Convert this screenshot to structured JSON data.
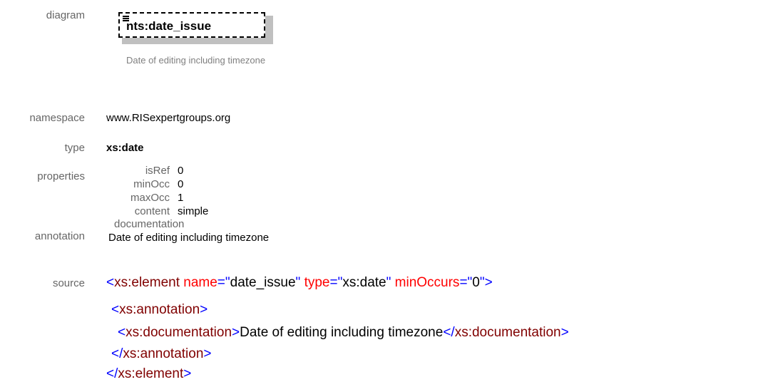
{
  "labels": {
    "diagram": "diagram",
    "namespace": "namespace",
    "type": "type",
    "properties": "properties",
    "annotation": "annotation",
    "source": "source"
  },
  "diagram": {
    "element_name": "nts:date_issue",
    "element_doc": "Date of editing including timezone"
  },
  "namespace": "www.RISexpertgroups.org",
  "type": "xs:date",
  "properties": [
    {
      "key": "isRef",
      "value": "0"
    },
    {
      "key": "minOcc",
      "value": "0"
    },
    {
      "key": "maxOcc",
      "value": "1"
    },
    {
      "key": "content",
      "value": "simple"
    }
  ],
  "annotation": {
    "heading": "documentation",
    "text": "Date of editing including timezone"
  },
  "source": {
    "line1": {
      "open": "<",
      "tag": "xs:element",
      "attr1": "name",
      "eq1": "=\"",
      "val1": "date_issue",
      "q1": "\"",
      "attr2": "type",
      "eq2": "=\"",
      "val2": "xs:date",
      "q2": "\"",
      "attr3": "minOccurs",
      "eq3": "=\"",
      "val3": "0",
      "q3": "\"",
      "close": ">"
    },
    "line2": {
      "open": "<",
      "tag": "xs:annotation",
      "close": ">"
    },
    "line3": {
      "open": "<",
      "tag": "xs:documentation",
      "close": ">",
      "text": "Date of editing including timezone",
      "end_open": "</",
      "end_tag": "xs:documentation",
      "end_close": ">"
    },
    "line4": {
      "open": "</",
      "tag": "xs:annotation",
      "close": ">"
    },
    "line5": {
      "open": "</",
      "tag": "xs:element",
      "close": ">"
    }
  },
  "colors": {
    "label": "#666666",
    "xml_bracket": "#0000ff",
    "xml_tag": "#800000",
    "xml_attr": "#ff0000",
    "diagram_doc": "#808080",
    "shadow": "#c0c0c0"
  }
}
